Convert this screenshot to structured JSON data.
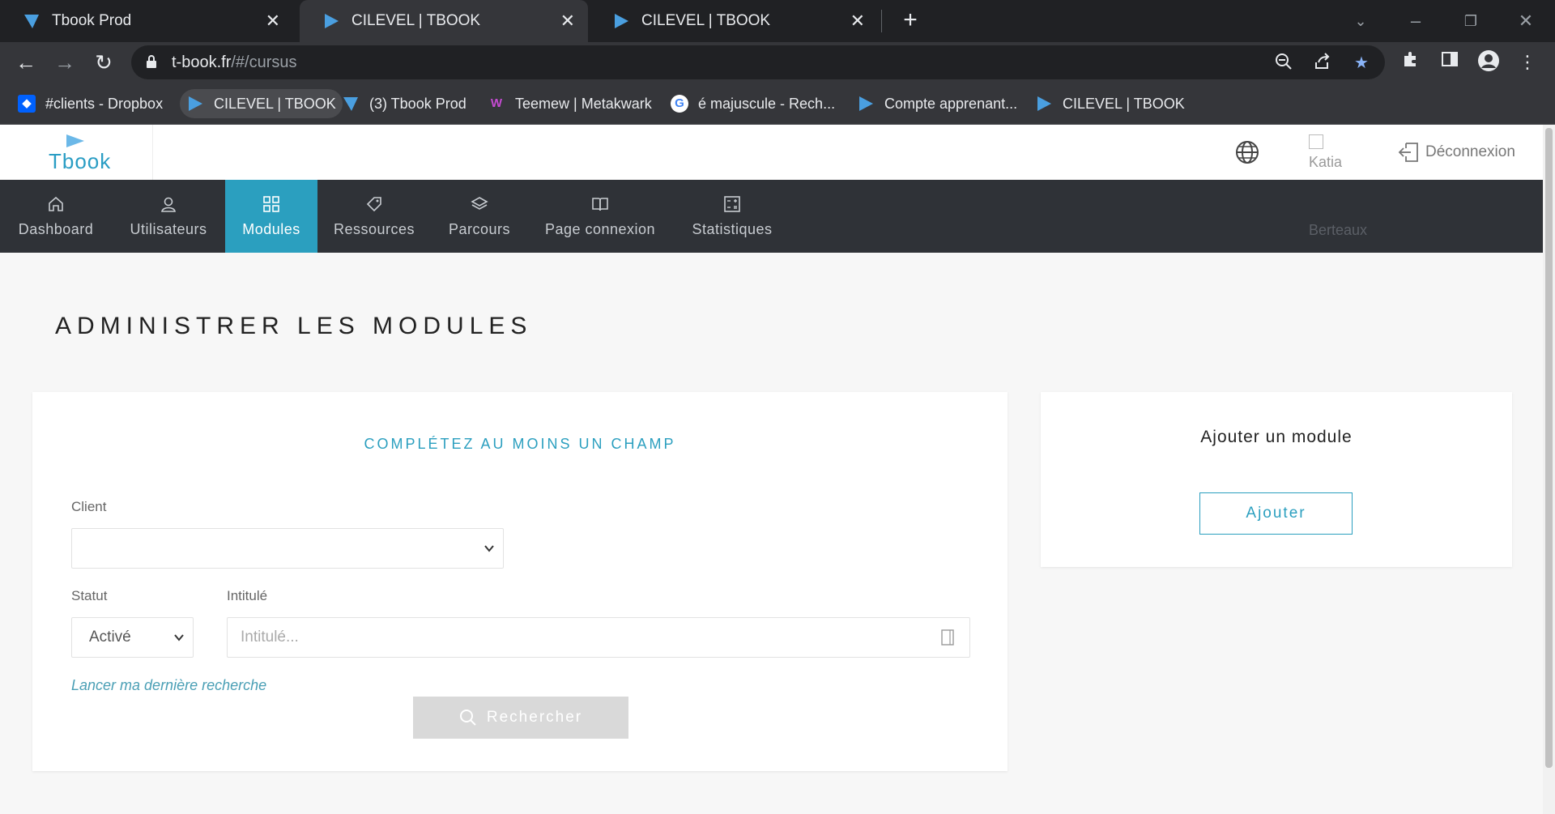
{
  "browser": {
    "tabs": [
      {
        "title": "Tbook Prod",
        "active": false
      },
      {
        "title": "CILEVEL | TBOOK",
        "active": true
      },
      {
        "title": "CILEVEL | TBOOK",
        "active": false
      }
    ],
    "url_host": "t-book.fr",
    "url_path": "/#/cursus",
    "bookmarks": [
      {
        "label": "#clients - Dropbox",
        "icon": "dropbox-icon"
      },
      {
        "label": "CILEVEL | TBOOK",
        "icon": "play-icon"
      },
      {
        "label": "(3) Tbook Prod",
        "icon": "tbook-icon"
      },
      {
        "label": "Teemew | Metakwark",
        "icon": "teemew-icon"
      },
      {
        "label": "é majuscule - Rech...",
        "icon": "google-icon"
      },
      {
        "label": "Compte apprenant...",
        "icon": "play-icon"
      },
      {
        "label": "CILEVEL | TBOOK",
        "icon": "play-icon"
      }
    ]
  },
  "header": {
    "logo_text": "Tbook",
    "user_alt_first": "Katia",
    "user_alt_last": "Berteaux",
    "logout_label": "Déconnexion"
  },
  "nav": {
    "items": [
      {
        "label": "Dashboard",
        "icon": "home-icon",
        "active": false
      },
      {
        "label": "Utilisateurs",
        "icon": "user-icon",
        "active": false
      },
      {
        "label": "Modules",
        "icon": "grid-icon",
        "active": true
      },
      {
        "label": "Ressources",
        "icon": "tag-icon",
        "active": false
      },
      {
        "label": "Parcours",
        "icon": "layers-icon",
        "active": false
      },
      {
        "label": "Page connexion",
        "icon": "book-icon",
        "active": false
      },
      {
        "label": "Statistiques",
        "icon": "calculator-icon",
        "active": false
      }
    ]
  },
  "page": {
    "title": "ADMINISTRER LES MODULES"
  },
  "search": {
    "heading": "COMPLÉTEZ AU MOINS UN CHAMP",
    "client_label": "Client",
    "client_value": "",
    "statut_label": "Statut",
    "statut_value": "Activé",
    "intitule_label": "Intitulé",
    "intitule_placeholder": "Intitulé...",
    "last_search_label": "Lancer ma dernière recherche",
    "search_button": "Rechercher"
  },
  "add_module": {
    "title": "Ajouter un module",
    "button": "Ajouter"
  },
  "colors": {
    "accent": "#2b9fbf",
    "nav_bg": "#2f3237",
    "page_bg": "#f7f7f7"
  }
}
